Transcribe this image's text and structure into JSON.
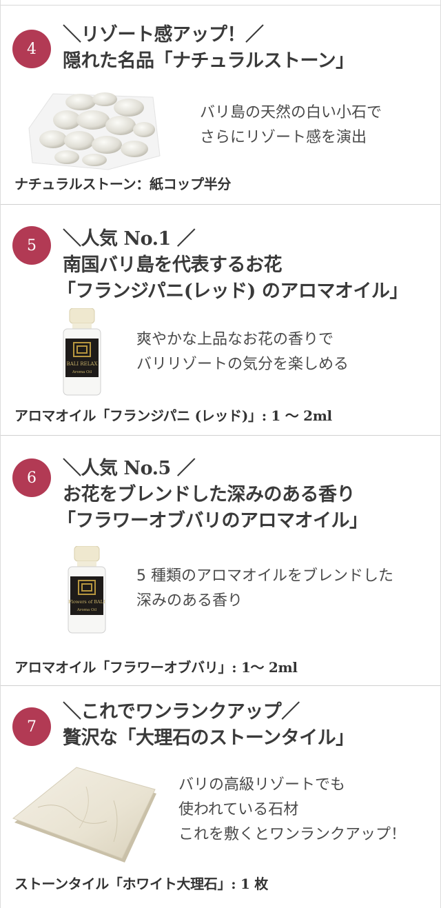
{
  "sections": [
    {
      "number": "4",
      "heading_line1": "＼リゾート感アップ！／",
      "heading_line2": "隠れた名品「ナチュラルストーン」",
      "description_line1": "バリ島の天然の白い小石で",
      "description_line2": "さらにリゾート感を演出",
      "caption": "ナチュラルストーン：紙コップ半分",
      "image_icon": "pebbles-in-bag-icon"
    },
    {
      "number": "5",
      "heading_line1": "＼人気 No.1 ／",
      "heading_line2": "南国バリ島を代表するお花",
      "heading_line3": "「フランジパニ(レッド) のアロマオイル」",
      "description_line1": "爽やかな上品なお花の香りで",
      "description_line2": "バリリゾートの気分を楽しめる",
      "caption": "アロマオイル「フランジパニ (レッド)」: 1 〜 2ml",
      "bottle_label_line1": "BALI RELAX",
      "bottle_label_line2": "Aroma Oil",
      "image_icon": "aroma-oil-bottle-icon"
    },
    {
      "number": "6",
      "heading_line1": "＼人気 No.5 ／",
      "heading_line2": "お花をブレンドした深みのある香り",
      "heading_line3": "「フラワーオブバリのアロマオイル」",
      "description_line1": "5 種類のアロマオイルをブレンドした",
      "description_line2": "深みのある香り",
      "caption": "アロマオイル「フラワーオブバリ」: 1〜 2ml",
      "bottle_label_line1": "Flowers of BALI",
      "bottle_label_line2": "Aroma Oil",
      "image_icon": "aroma-oil-bottle-icon"
    },
    {
      "number": "7",
      "heading_line1": "＼これでワンランクアップ／",
      "heading_line2": "贅沢な「大理石のストーンタイル」",
      "description_line1": "バリの高級リゾートでも",
      "description_line2": "使われている石材",
      "description_line3": "これを敷くとワンランクアップ！",
      "caption": "ストーンタイル「ホワイト大理石」: 1 枚",
      "image_icon": "marble-tile-icon"
    }
  ],
  "colors": {
    "badge": "#b23a54",
    "text": "#3a3a3a",
    "divider": "#d0d0d0"
  }
}
